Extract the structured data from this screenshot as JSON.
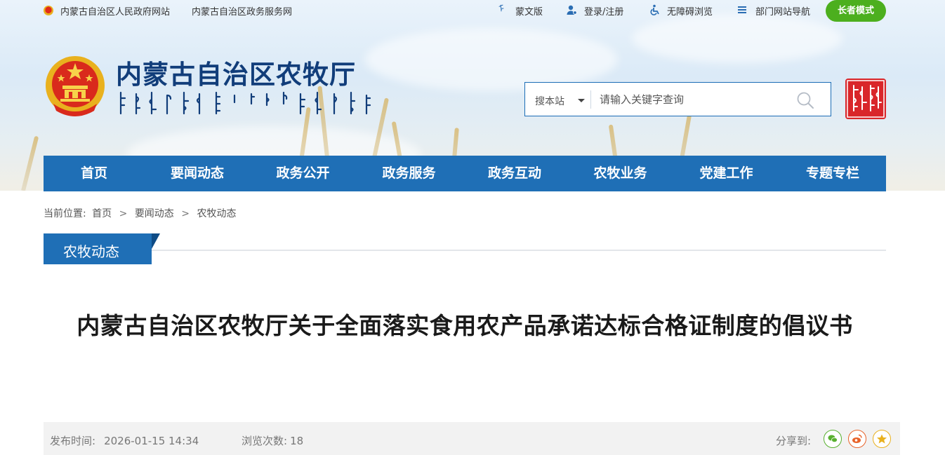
{
  "topbar": {
    "links": [
      "内蒙古自治区人民政府网站",
      "内蒙古自治区政务服务网"
    ],
    "mongolian_version": "蒙文版",
    "login": "登录/注册",
    "accessibility": "无障碍浏览",
    "dept_nav": "部门网站导航",
    "elder_mode": "长者模式"
  },
  "site": {
    "title": "内蒙古自治区农牧厅"
  },
  "search": {
    "scope": "搜本站",
    "placeholder": "请输入关键字查询"
  },
  "nav": {
    "items": [
      "首页",
      "要闻动态",
      "政务公开",
      "政务服务",
      "政务互动",
      "农牧业务",
      "党建工作",
      "专题专栏"
    ]
  },
  "breadcrumb": {
    "prefix": "当前位置:",
    "items": [
      "首页",
      "要闻动态",
      "农牧动态"
    ],
    "separator": ">"
  },
  "section": {
    "title": "农牧动态"
  },
  "article": {
    "title": "内蒙古自治区农牧厅关于全面落实食用农产品承诺达标合格证制度的倡议书",
    "publish_label": "发布时间:",
    "publish_time": "2026-01-15 14:34",
    "views_label": "浏览次数:",
    "views": "18",
    "share_label": "分享到:"
  },
  "colors": {
    "nav_blue": "#1f6fb6",
    "elder_green": "#4caf1e",
    "title_navy": "#113d7a",
    "wechat_green": "#58b02f",
    "weibo_orange": "#e8632a",
    "qzone_gold": "#e9b11e"
  },
  "icons": {
    "mongolian": "mongolian-script-icon",
    "login": "user-icon",
    "accessibility": "wheelchair-icon",
    "dept_nav": "list-icon",
    "search": "search-icon",
    "wechat": "wechat-icon",
    "weibo": "weibo-icon",
    "qzone": "qzone-star-icon"
  }
}
